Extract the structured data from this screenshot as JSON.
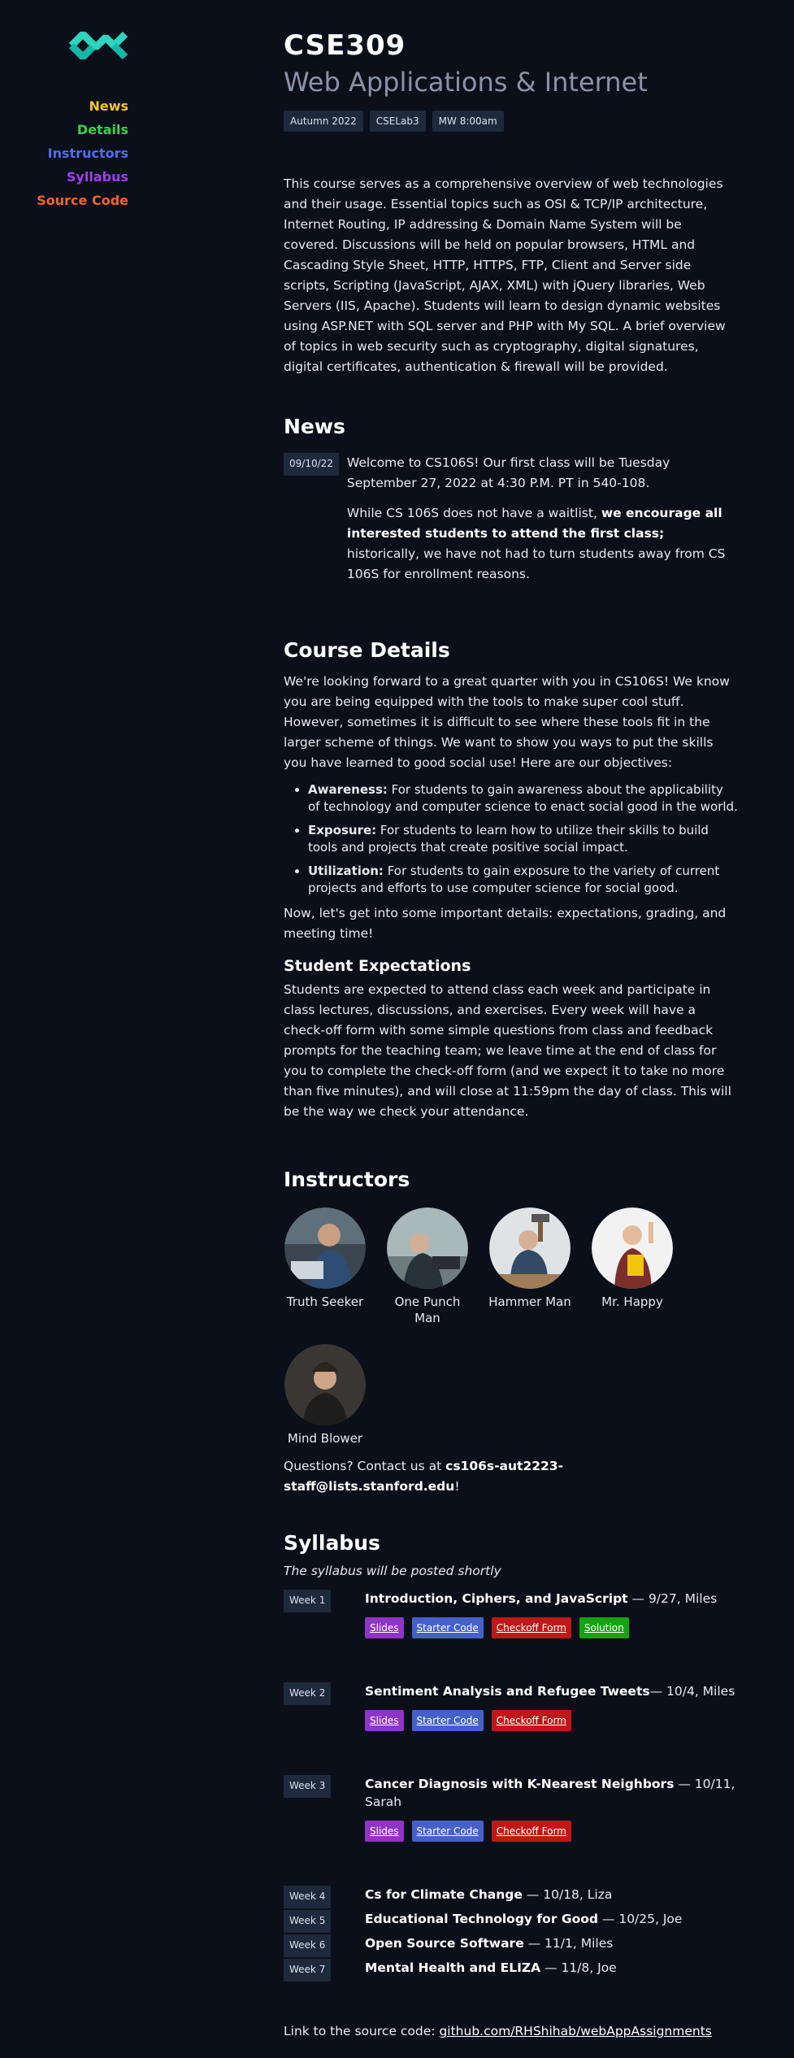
{
  "nav": [
    {
      "label": "News",
      "color": "#f4c430"
    },
    {
      "label": "Details",
      "color": "#3ccf4e"
    },
    {
      "label": "Instructors",
      "color": "#4f6df5"
    },
    {
      "label": "Syllabus",
      "color": "#a23cf4"
    },
    {
      "label": "Source Code",
      "color": "#f4632a"
    }
  ],
  "header": {
    "code": "CSE309",
    "title": "Web Applications & Internet",
    "tags": [
      "Autumn 2022",
      "CSELab3",
      "MW 8:00am"
    ]
  },
  "description": "This course serves as a comprehensive overview of web technologies and their usage. Essential topics such as OSI & TCP/IP architecture, Internet Routing, IP addressing & Domain Name System will be covered. Discussions will be held on popular browsers, HTML and Cascading Style Sheet, HTTP, HTTPS, FTP, Client and Server side scripts, Scripting (JavaScript, AJAX, XML) with jQuery libraries, Web Servers (IIS, Apache). Students will learn to design dynamic websites using ASP.NET with SQL server and PHP with My SQL. A brief overview of topics in web security such as cryptography, digital signatures, digital certificates, authentication & firewall will be provided.",
  "news": {
    "heading": "News",
    "date": "09/10/22",
    "p1": "Welcome to CS106S! Our first class will be Tuesday September 27, 2022 at 4:30 P.M. PT in 540-108.",
    "p2_a": "While CS 106S does not have a waitlist, ",
    "p2_b": "we encourage all interested students to attend the first class;",
    "p2_c": " historically, we have not had to turn students away from CS 106S for enrollment reasons."
  },
  "details": {
    "heading": "Course Details",
    "intro": "We're looking forward to a great quarter with you in CS106S! We know you are being equipped with the tools to make super cool stuff. However, sometimes it is difficult to see where these tools fit in the larger scheme of things. We want to show you ways to put the skills you have learned to good social use! Here are our objectives:",
    "objectives": [
      {
        "term": "Awareness:",
        "text": " For students to gain awareness about the applicability of technology and computer science to enact social good in the world."
      },
      {
        "term": "Exposure:",
        "text": " For students to learn how to utilize their skills to build tools and projects that create positive social impact."
      },
      {
        "term": "Utilization:",
        "text": " For students to gain exposure to the variety of current projects and efforts to use computer science for social good."
      }
    ],
    "outro": "Now, let's get into some important details: expectations, grading, and meeting time!",
    "expectations_heading": "Student Expectations",
    "expectations": "Students are expected to attend class each week and participate in class lectures, discussions, and exercises. Every week will have a check-off form with some simple questions from class and feedback prompts for the teaching team; we leave time at the end of class for you to complete the check-off form (and we expect it to take no more than five minutes), and will close at 11:59pm the day of class. This will be the way we check your attendance."
  },
  "instructors": {
    "heading": "Instructors",
    "people": [
      "Truth Seeker",
      "One Punch Man",
      "Hammer Man",
      "Mr. Happy",
      "Mind Blower"
    ],
    "contact_prefix": "Questions? Contact us at ",
    "contact_email": "cs106s-aut2223-staff@lists.stanford.edu",
    "contact_suffix": "!"
  },
  "syllabus": {
    "heading": "Syllabus",
    "note": "The syllabus will be posted shortly",
    "weeks": [
      {
        "label": "Week 1",
        "title": "Introduction, Ciphers, and JavaScript",
        "meta": " — 9/27, Miles",
        "buttons": [
          "Slides",
          "Starter Code",
          "Checkoff Form",
          "Solution"
        ]
      },
      {
        "label": "Week 2",
        "title": "Sentiment Analysis and Refugee Tweets",
        "meta": "— 10/4, Miles",
        "buttons": [
          "Slides",
          "Starter Code",
          "Checkoff Form"
        ]
      },
      {
        "label": "Week 3",
        "title": "Cancer Diagnosis with K-Nearest Neighbors",
        "meta": " — 10/11, Sarah",
        "buttons": [
          "Slides",
          "Starter Code",
          "Checkoff Form"
        ]
      }
    ],
    "short_weeks": [
      {
        "label": "Week 4",
        "title": "Cs for Climate Change",
        "meta": " — 10/18, Liza"
      },
      {
        "label": "Week 5",
        "title": "Educational Technology for Good",
        "meta": " — 10/25, Joe"
      },
      {
        "label": "Week 6",
        "title": "Open Source Software",
        "meta": " — 11/1, Miles"
      },
      {
        "label": "Week 7",
        "title": "Mental Health and ELIZA",
        "meta": " — 11/8, Joe"
      }
    ],
    "button_colors": {
      "Slides": "#8e35c5",
      "Starter Code": "#4561c9",
      "Checkoff Form": "#c01818",
      "Solution": "#15a315"
    }
  },
  "footer": {
    "prefix": "Link to the source code: ",
    "link": "github.com/RHShihab/webAppAssignments"
  }
}
